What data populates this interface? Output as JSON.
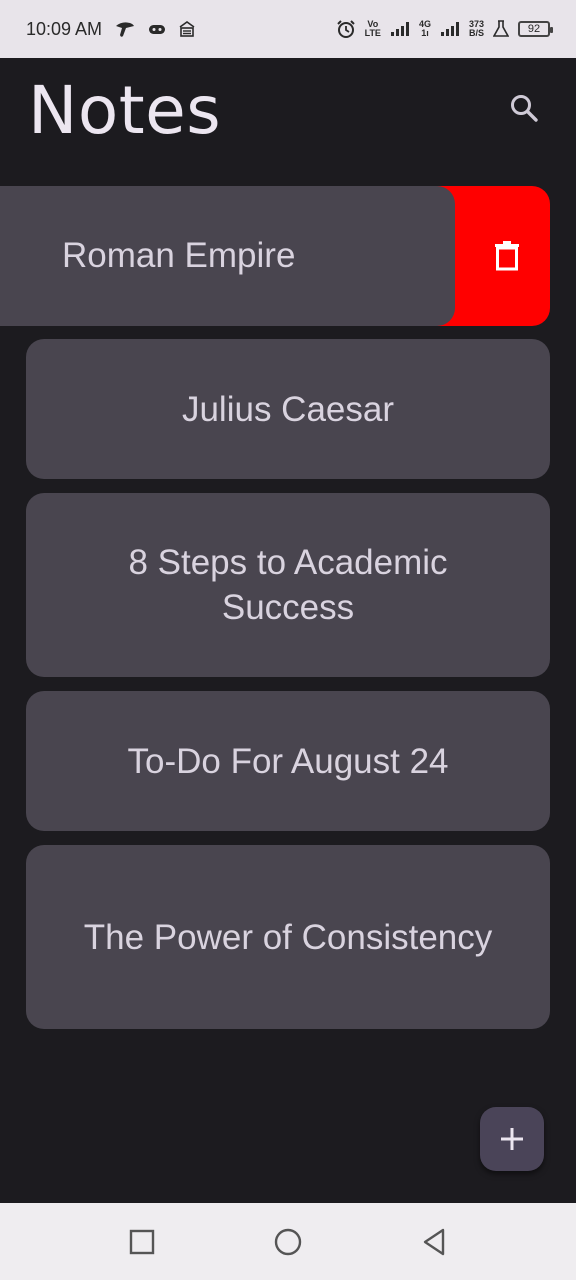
{
  "status_bar": {
    "time": "10:09 AM",
    "volte_top": "Vo",
    "volte_bottom": "LTE",
    "net_type_top": "4G",
    "net_type_bottom": "1ı",
    "speed_top": "373",
    "speed_bottom": "B/S",
    "battery": "92",
    "icons": [
      "telenor-icon",
      "game-controller-icon",
      "vpn-key-icon",
      "alarm-icon",
      "signal-bars-icon",
      "flask-icon",
      "battery-icon"
    ]
  },
  "header": {
    "title": "Notes",
    "search_icon": "search-icon"
  },
  "notes": [
    {
      "title": "Roman Empire",
      "swiped": true
    },
    {
      "title": "Julius Caesar"
    },
    {
      "title": "8 Steps to Academic Success"
    },
    {
      "title": "To-Do For August 24"
    },
    {
      "title": "The Power of Consistency"
    }
  ],
  "delete_action": {
    "icon": "trash-icon",
    "color": "#ff0000"
  },
  "fab": {
    "icon": "plus-icon",
    "color": "#4a4458"
  },
  "nav": {
    "icons": [
      "recents-square-icon",
      "home-circle-icon",
      "back-triangle-icon"
    ]
  },
  "colors": {
    "background": "#1c1b1f",
    "card": "#49454f",
    "card_text": "#d9d3df",
    "title_text": "#ece6f0"
  }
}
